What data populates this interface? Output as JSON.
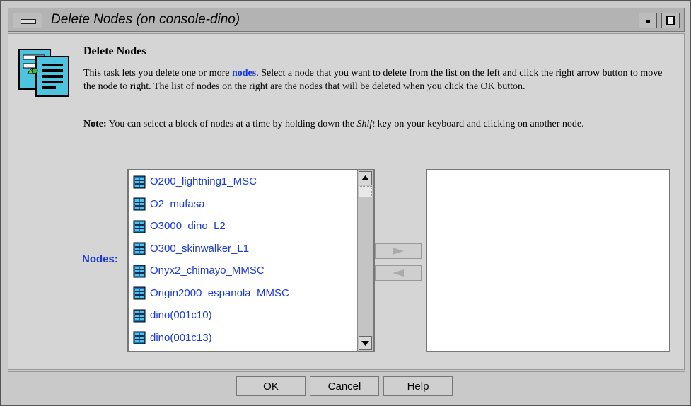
{
  "window": {
    "title": "Delete Nodes (on console-dino)"
  },
  "header": {
    "heading": "Delete Nodes",
    "desc_pre": "This task lets you delete one or more ",
    "desc_link": "nodes",
    "desc_post": ".  Select a node that you want to delete from the list on the left and click the right arrow button to move the node to right. The list of nodes on the right are the nodes that will be deleted when you click the OK button.",
    "note_label": "Note:",
    "note_pre": " You can select a block of nodes at a time by holding down the ",
    "note_key": "Shift",
    "note_post": " key on your keyboard and clicking on another node."
  },
  "nodes": {
    "label": "Nodes:",
    "items": [
      "O200_lightning1_MSC",
      "O2_mufasa",
      "O3000_dino_L2",
      "O300_skinwalker_L1",
      "Onyx2_chimayo_MMSC",
      "Origin2000_espanola_MMSC",
      "dino(001c10)",
      "dino(001c13)"
    ],
    "icon": "node-icon",
    "selected_items": []
  },
  "buttons": {
    "ok": "OK",
    "cancel": "Cancel",
    "help": "Help"
  },
  "colors": {
    "link": "#1a3ad0",
    "background": "#d5d5d5",
    "list_bg": "#ffffff"
  }
}
